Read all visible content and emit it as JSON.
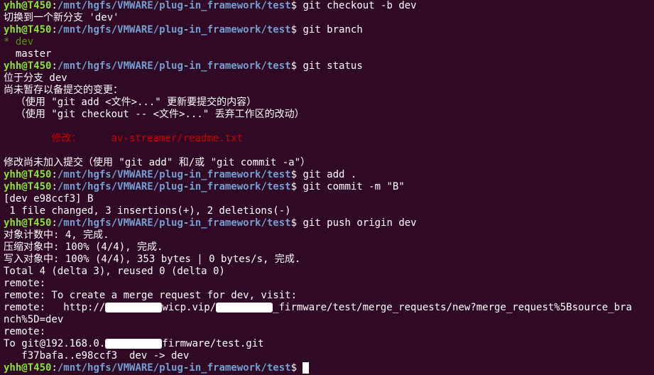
{
  "colors": {
    "background": "#300a24",
    "foreground": "#ffffff",
    "prompt_user": "#8ae234",
    "prompt_path": "#729fcf",
    "branch_green": "#4e9a06",
    "modified_red": "#cc0000"
  },
  "prompt": {
    "user": "yhh@T450",
    "colon": ":",
    "path": "/mnt/hgfs/VMWARE/plug-in_framework/test",
    "symbol": "$ "
  },
  "lines": [
    {
      "cmd": "git checkout -b dev"
    },
    {
      "out": "切换到一个新分支 'dev'"
    },
    {
      "cmd": "git branch"
    },
    {
      "current_branch": "* dev"
    },
    {
      "out": "  master"
    },
    {
      "cmd": "git status"
    },
    {
      "out": "位于分支 dev"
    },
    {
      "out": "尚未暂存以备提交的变更："
    },
    {
      "out": "  （使用 \"git add <文件>...\" 更新要提交的内容）"
    },
    {
      "out": "  （使用 \"git checkout -- <文件>...\" 丢弃工作区的改动）"
    },
    {
      "out": ""
    },
    {
      "modified_label": "        修改：     ",
      "modified_file": "av-streamer/readme.txt"
    },
    {
      "out": ""
    },
    {
      "out": "修改尚未加入提交（使用 \"git add\" 和/或 \"git commit -a\"）"
    },
    {
      "cmd": "git add ."
    },
    {
      "cmd": "git commit -m \"B\""
    },
    {
      "out": "[dev e98ccf3] B"
    },
    {
      "out": " 1 file changed, 3 insertions(+), 2 deletions(-)"
    },
    {
      "cmd": "git push origin dev"
    },
    {
      "out": "对象计数中: 4, 完成."
    },
    {
      "out": "压缩对象中: 100% (4/4), 完成."
    },
    {
      "out": "写入对象中: 100% (4/4), 353 bytes | 0 bytes/s, 完成."
    },
    {
      "out": "Total 4 (delta 3), reused 0 (delta 0)"
    },
    {
      "out": "remote:"
    },
    {
      "out": "remote: To create a merge request for dev, visit:"
    },
    {
      "out_parts": [
        "remote:   http://",
        "wicp.vip/",
        "_firmware/test/merge_requests/new?merge_request%5Bsource_bra"
      ]
    },
    {
      "out": "nch%5D=dev"
    },
    {
      "out": "remote:"
    },
    {
      "out_parts": [
        "To git@192.168.0.",
        "firmware/test.git"
      ]
    },
    {
      "out": "   f37bafa..e98ccf3  dev -> dev"
    },
    {
      "prompt_only": true
    }
  ]
}
